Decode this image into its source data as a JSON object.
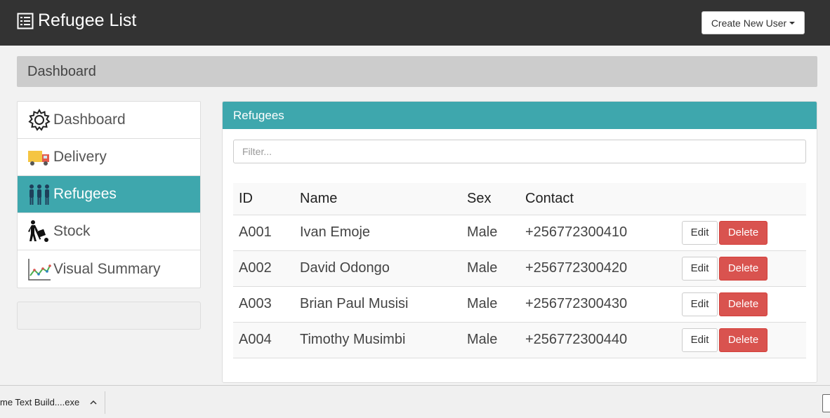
{
  "header": {
    "title": "Refugee List",
    "create_button": "Create New User"
  },
  "breadcrumb": "Dashboard",
  "sidebar": {
    "items": [
      {
        "label": "Dashboard",
        "icon": "gear-icon"
      },
      {
        "label": "Delivery",
        "icon": "delivery-truck-icon"
      },
      {
        "label": "Refugees",
        "icon": "people-icon",
        "active": true
      },
      {
        "label": "Stock",
        "icon": "hand-truck-icon"
      },
      {
        "label": "Visual Summary",
        "icon": "line-chart-icon"
      }
    ]
  },
  "panel": {
    "title": "Refugees",
    "filter_placeholder": "Filter...",
    "columns": [
      "ID",
      "Name",
      "Sex",
      "Contact"
    ],
    "rows": [
      {
        "id": "A001",
        "name": "Ivan Emoje",
        "sex": "Male",
        "contact": "+256772300410"
      },
      {
        "id": "A002",
        "name": "David Odongo",
        "sex": "Male",
        "contact": "+256772300420"
      },
      {
        "id": "A003",
        "name": "Brian Paul Musisi",
        "sex": "Male",
        "contact": "+256772300430"
      },
      {
        "id": "A004",
        "name": "Timothy Musimbi",
        "sex": "Male",
        "contact": "+256772300440"
      }
    ],
    "edit_label": "Edit",
    "delete_label": "Delete"
  },
  "taskbar": {
    "download_name": "me Text Build....exe"
  },
  "colors": {
    "topbar": "#333333",
    "accent": "#3ea7ad",
    "danger": "#d9534f"
  }
}
